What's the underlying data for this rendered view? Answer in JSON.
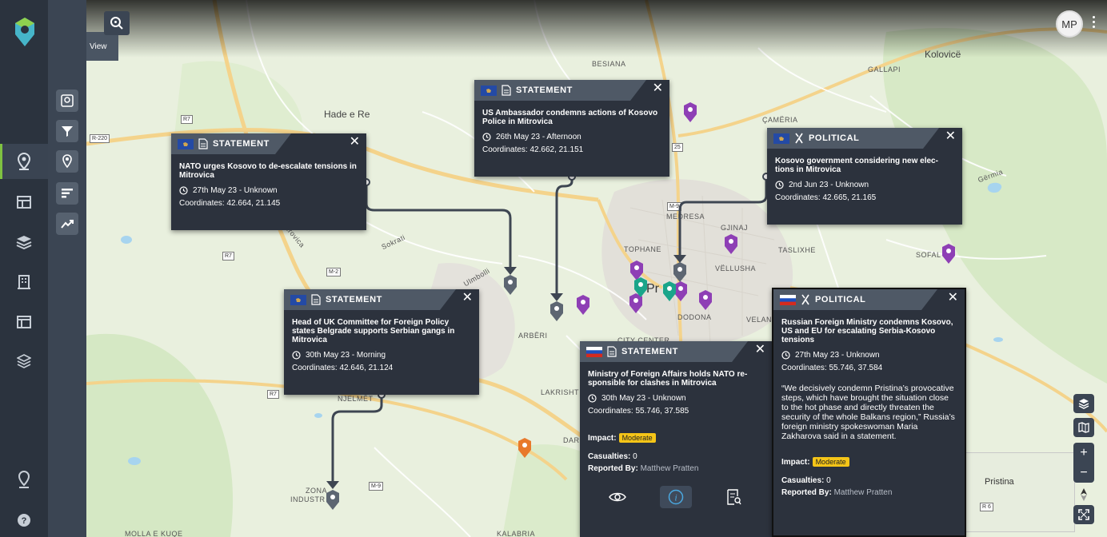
{
  "toolbar": {
    "view_label": "View"
  },
  "user": {
    "initials": "MP"
  },
  "rail_icons": [
    "map-pin-icon",
    "table-icon",
    "layers-icon",
    "building-icon",
    "dashboard-icon",
    "stack-icon",
    "location-icon",
    "help-icon"
  ],
  "tool_icons": [
    "map-pin-search-icon",
    "filter-icon",
    "marker-icon",
    "bars-icon",
    "trend-icon"
  ],
  "map_labels": {
    "hade": "Hade e Re",
    "kolovice": "Kolovicë",
    "besiana": "BESIANA",
    "gallapi": "GALLAPI",
    "cameria": "ÇAMËRIA",
    "medresa": "MEDRESA",
    "gjinaj": "GJINAJ",
    "taslixhe": "TASLIXHE",
    "sofali": "SOFAL",
    "tophane": "TOPHANE",
    "vellusha": "VËLLUSHA",
    "dodona": "DODONA",
    "city_center": "CITY CENTER",
    "arberi": "ARBËRI",
    "lakrishte": "LAKRISHT",
    "njelmet": "NJELMËT",
    "zona": "ZONA",
    "industr": "INDUSTR",
    "kalabria": "KALABRIA",
    "molla": "MOLLA E KUQE",
    "pristina_center": "Pr     a",
    "pristina_mini": "Pristina",
    "mitrovica_road": "Mitrovica",
    "sokrati": "Sokrati",
    "ulmbolli": "Ulmbolli",
    "gërmia": "Gërmia",
    "dar": "DAR",
    "velan": "VELAN",
    "r7": "R7",
    "r220": "R-220",
    "m2": "M-2",
    "m9": "M-9",
    "m25": "25",
    "r6": "R 6"
  },
  "cards": [
    {
      "category": "STATEMENT",
      "flag": "kosovo",
      "type_icon": "document-icon",
      "title": "NATO urges Kosovo to de-escalate tensions in Mitrovica",
      "datetime": "27th May 23 - Unknown",
      "coordinates": "Coordinates: 42.664, 21.145"
    },
    {
      "category": "STATEMENT",
      "flag": "kosovo",
      "type_icon": "document-icon",
      "title": "US Ambassador condemns actions of Kosovo Police in Mitrovica",
      "datetime": "26th May 23 - Afternoon",
      "coordinates": "Coordinates: 42.662, 21.151"
    },
    {
      "category": "POLITICAL",
      "flag": "kosovo",
      "type_icon": "political-icon",
      "title": "Kosovo government considering new elec-tions in Mitrovica",
      "datetime": "2nd Jun 23 - Unknown",
      "coordinates": "Coordinates: 42.665, 21.165"
    },
    {
      "category": "STATEMENT",
      "flag": "kosovo",
      "type_icon": "document-icon",
      "title": "Head of UK Committee for Foreign Policy states Belgrade supports Serbian gangs in Mitrovica",
      "datetime": "30th May 23 - Morning",
      "coordinates": "Coordinates: 42.646, 21.124"
    },
    {
      "category": "STATEMENT",
      "flag": "russia",
      "type_icon": "document-icon",
      "title": "Ministry of Foreign Affairs holds NATO re-sponsible for clashes in Mitrovica",
      "datetime": "30th May 23 - Unknown",
      "coordinates": "Coordinates: 55.746, 37.585",
      "impact_label": "Impact:",
      "impact_value": "Moderate",
      "casualties_label": "Casualties:",
      "casualties_value": "0",
      "reported_label": "Reported By:",
      "reported_value": "Matthew Pratten"
    },
    {
      "category": "POLITICAL",
      "flag": "russia",
      "type_icon": "political-icon",
      "title": "Russian Foreign Ministry condemns Kosovo, US and EU for escalating Serbia-Kosovo tensions",
      "datetime": "27th May 23 - Unknown",
      "coordinates": "Coordinates: 55.746, 37.584",
      "quote": "“We decisively condemn Pristina’s provocative steps, which have brought the situation close to the hot phase and directly threaten the security of the whole Balkans region,” Russia’s foreign ministry spokeswoman Maria Zakharova said in a statement.",
      "impact_label": "Impact:",
      "impact_value": "Moderate",
      "casualties_label": "Casualties:",
      "casualties_value": "0",
      "reported_label": "Reported By:",
      "reported_value": "Matthew Pratten"
    }
  ],
  "colors": {
    "accent": "#7fc241",
    "moderate": "#f5c518",
    "pin_purple": "#8e3fb5",
    "pin_teal": "#1aa58a",
    "pin_orange": "#e8792b",
    "pin_grey": "#5d6672"
  }
}
